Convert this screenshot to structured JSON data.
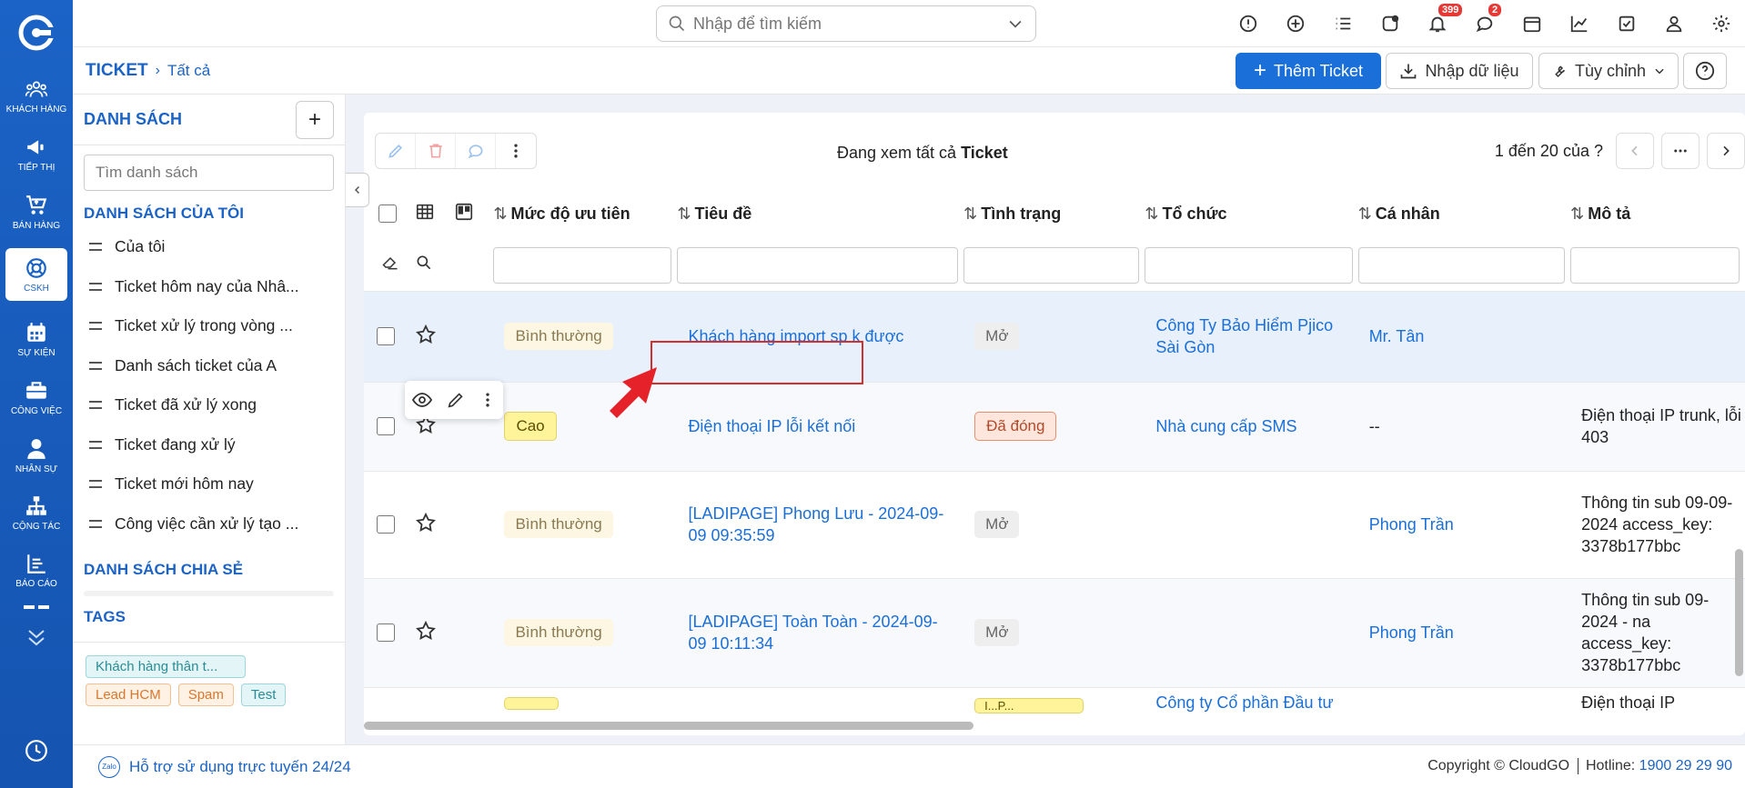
{
  "rail": {
    "items": [
      {
        "label": "Khách hàng",
        "icon": "users-icon"
      },
      {
        "label": "Tiếp thị",
        "icon": "megaphone-icon"
      },
      {
        "label": "Bán hàng",
        "icon": "cart-icon"
      },
      {
        "label": "CSKH",
        "icon": "lifebuoy-icon",
        "active": true
      },
      {
        "label": "Sự kiện",
        "icon": "calendar-icon"
      },
      {
        "label": "Công việc",
        "icon": "briefcase-icon"
      },
      {
        "label": "Nhân sự",
        "icon": "person-icon"
      },
      {
        "label": "Cộng tác",
        "icon": "org-chart-icon"
      },
      {
        "label": "Báo cáo",
        "icon": "report-icon"
      }
    ]
  },
  "topbar": {
    "search_placeholder": "Nhập để tìm kiếm",
    "notifications_badge": "399",
    "messages_badge": "2"
  },
  "breadcrumb": {
    "root": "TICKET",
    "current": "Tất cả"
  },
  "actions": {
    "add_label": "Thêm Ticket",
    "import_label": "Nhập dữ liệu",
    "customize_label": "Tùy chỉnh"
  },
  "listpanel": {
    "title": "DANH SÁCH",
    "search_placeholder": "Tìm danh sách",
    "my_lists_title": "DANH SÁCH CỦA TÔI",
    "my_lists": [
      "Của tôi",
      "Ticket hôm nay của Nhâ...",
      "Ticket xử lý trong vòng ...",
      "Danh sách ticket của A",
      "Ticket đã xử lý xong",
      "Ticket đang xử lý",
      "Ticket mới hôm nay",
      "Công việc cần xử lý tạo ..."
    ],
    "shared_title": "DANH SÁCH CHIA SẺ",
    "tags_title": "TAGS",
    "tags": [
      "Khách hàng thân t...",
      "Lead HCM",
      "Spam",
      "Test"
    ]
  },
  "main": {
    "viewing_prefix": "Đang xem tất cả",
    "viewing_module": "Ticket",
    "page_count": "1 đến 20 của",
    "page_count_unknown": "?",
    "columns": [
      "Mức độ ưu tiên",
      "Tiêu đề",
      "Tình trạng",
      "Tổ chức",
      "Cá nhân",
      "Mô tả"
    ],
    "rows": [
      {
        "priority": "Bình thường",
        "title": "Khách hàng import sp k được",
        "status": "Mở",
        "org": "Công Ty Bảo Hiểm Pjico Sài Gòn",
        "person": "Mr. Tân",
        "desc": ""
      },
      {
        "priority": "Cao",
        "title": "Điện thoại IP lỗi kết nối",
        "status": "Đã đóng",
        "org": "Nhà cung cấp SMS",
        "person": "--",
        "desc": "Điện thoại IP trunk, lỗi 403"
      },
      {
        "priority": "Bình thường",
        "title": "[LADIPAGE] Phong Lưu - 2024-09-09 09:35:59",
        "status": "Mở",
        "org": "",
        "person": "Phong Trần",
        "desc": "Thông tin sub 09-09-2024 access_key: 3378b177bbc"
      },
      {
        "priority": "Bình thường",
        "title": "[LADIPAGE] Toàn Toàn - 2024-09-09 10:11:34",
        "status": "Mở",
        "org": "",
        "person": "Phong Trần",
        "desc": "Thông tin sub 09-2024 - na access_key: 3378b177bbc"
      },
      {
        "priority": "",
        "title": "",
        "status": "I...P...",
        "org": "Công ty Cổ phần Đầu tư",
        "person": "",
        "desc": "Điện thoại IP"
      }
    ]
  },
  "footer": {
    "zalo": "Zalo",
    "support": "Hỗ trợ sử dụng trực tuyến 24/24",
    "copyright": "Copyright © CloudGO",
    "hotline_label": "Hotline:",
    "hotline": "1900 29 29 90"
  }
}
